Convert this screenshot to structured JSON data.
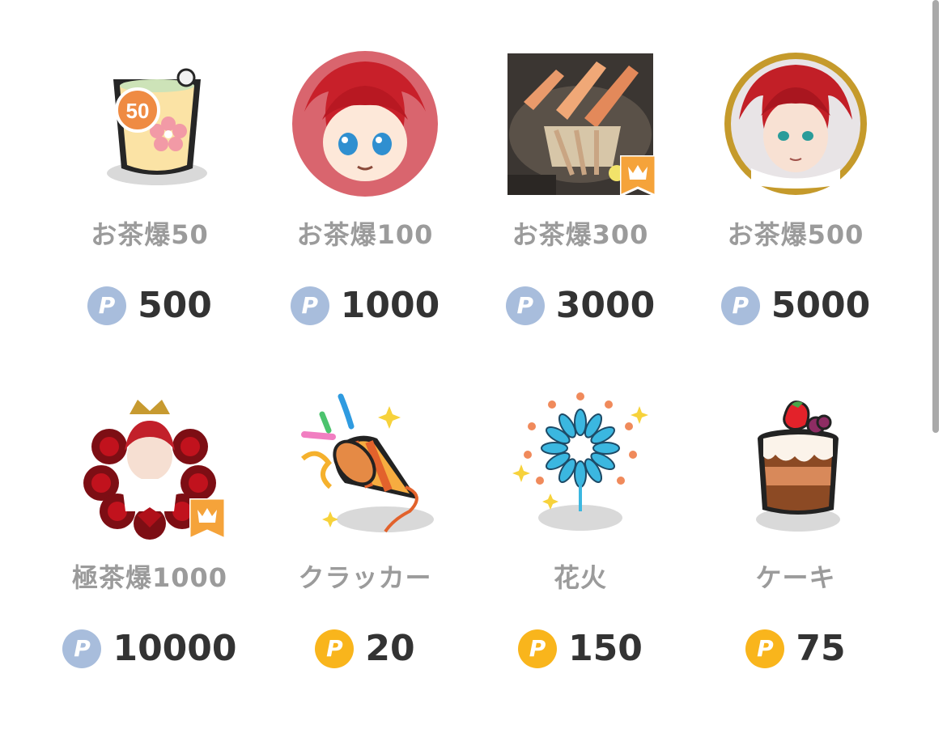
{
  "gifts": [
    {
      "name": "お茶爆50",
      "price": "500",
      "coin": "P",
      "coin_type": "paid",
      "icon": "tea-cup-50-icon"
    },
    {
      "name": "お茶爆100",
      "price": "1000",
      "coin": "P",
      "coin_type": "paid",
      "icon": "chibi-avatar-icon"
    },
    {
      "name": "お茶爆300",
      "price": "3000",
      "coin": "P",
      "coin_type": "paid",
      "icon": "crab-dish-photo",
      "premium": true
    },
    {
      "name": "お茶爆500",
      "price": "5000",
      "coin": "P",
      "coin_type": "paid",
      "icon": "gold-frame-avatar-icon"
    },
    {
      "name": "極茶爆1000",
      "price": "10000",
      "coin": "P",
      "coin_type": "paid",
      "icon": "rose-crown-avatar-icon",
      "premium": true
    },
    {
      "name": "クラッカー",
      "price": "20",
      "coin": "P",
      "coin_type": "free",
      "icon": "party-popper-icon"
    },
    {
      "name": "花火",
      "price": "150",
      "coin": "P",
      "coin_type": "free",
      "icon": "fireworks-icon"
    },
    {
      "name": "ケーキ",
      "price": "75",
      "coin": "P",
      "coin_type": "free",
      "icon": "cake-icon"
    }
  ],
  "tea_badge": "50",
  "colors": {
    "paid_coin": "#a8bddc",
    "free_coin": "#f9b51c",
    "premium_badge": "#f5a33a",
    "label": "#9b9b9b",
    "amount": "#333333"
  }
}
